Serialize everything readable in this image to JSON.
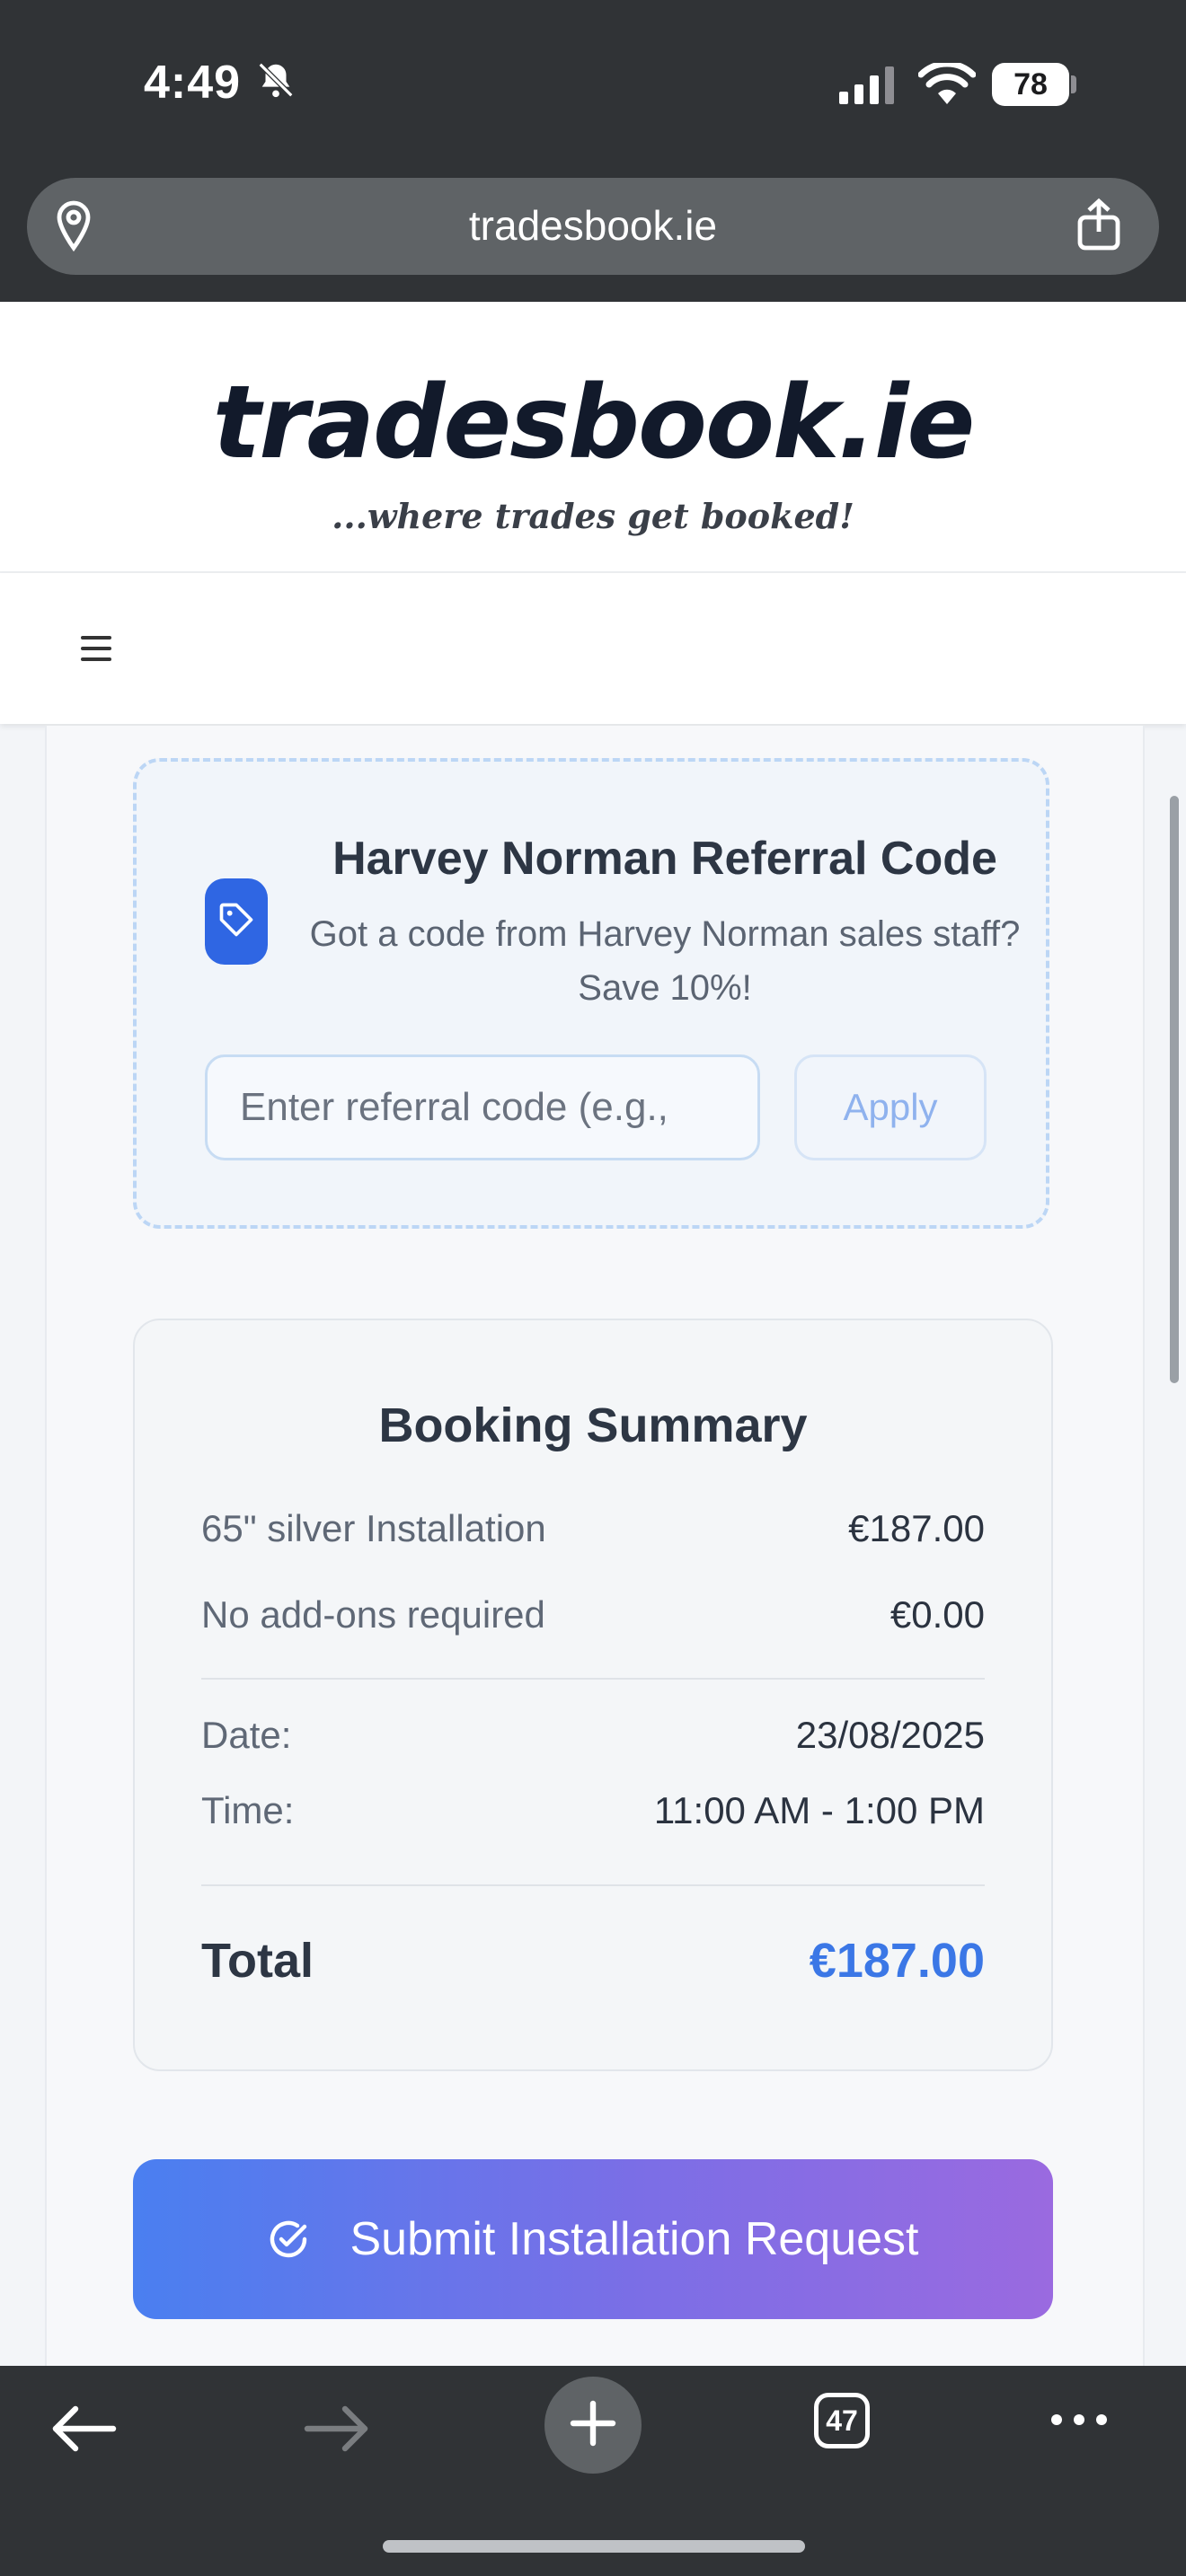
{
  "status_bar": {
    "time": "4:49",
    "battery": "78"
  },
  "browser": {
    "url": "tradesbook.ie",
    "tabs_count": "47"
  },
  "site": {
    "logo": "tradesbook.ie",
    "tagline": "...where trades get booked!"
  },
  "referral": {
    "title": "Harvey Norman Referral Code",
    "subtitle": "Got a code from Harvey Norman sales staff? Save 10%!",
    "input_placeholder": "Enter referral code (e.g.,",
    "apply_label": "Apply"
  },
  "summary": {
    "title": "Booking Summary",
    "items": [
      {
        "label": "65\" silver Installation",
        "value": "€187.00"
      },
      {
        "label": "No add-ons required",
        "value": "€0.00"
      }
    ],
    "date_label": "Date:",
    "date_value": "23/08/2025",
    "time_label": "Time:",
    "time_value": "11:00 AM - 1:00 PM",
    "total_label": "Total",
    "total_value": "€187.00"
  },
  "actions": {
    "submit_label": "Submit Installation Request"
  },
  "colors": {
    "accent": "#3b77e6",
    "gradient_start": "#4a7ff0",
    "gradient_end": "#9a6ae0",
    "tag_badge": "#2f66e3"
  }
}
